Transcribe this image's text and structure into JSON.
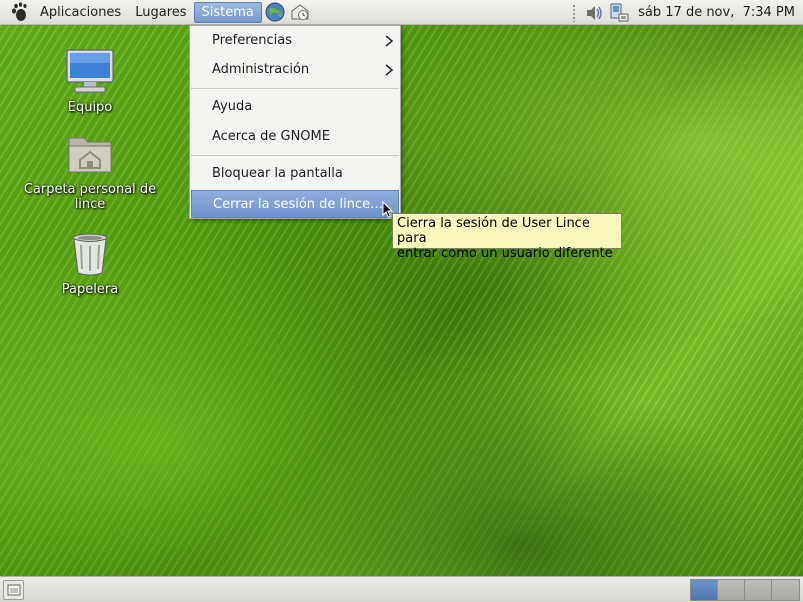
{
  "top_panel": {
    "menus": [
      "Aplicaciones",
      "Lugares",
      "Sistema"
    ],
    "active_menu": "Sistema",
    "launchers": [
      "web-browser-icon",
      "mail-client-icon"
    ],
    "tray_icons": [
      "volume-icon",
      "network-icon"
    ],
    "clock": "sáb 17 de nov,  7:34 PM"
  },
  "desktop": {
    "icons": [
      {
        "label": "Equipo",
        "icon": "computer-icon"
      },
      {
        "label": "Carpeta personal de lince",
        "icon": "home-folder-icon"
      },
      {
        "label": "Papelera",
        "icon": "trash-icon"
      }
    ]
  },
  "sistema_menu": {
    "groups": [
      [
        {
          "label": "Preferencias",
          "submenu": true
        },
        {
          "label": "Administración",
          "submenu": true
        }
      ],
      [
        {
          "label": "Ayuda",
          "submenu": false
        },
        {
          "label": "Acerca de GNOME",
          "submenu": false
        }
      ],
      [
        {
          "label": "Bloquear la pantalla",
          "submenu": false
        },
        {
          "label": "Cerrar la sesión de lince…",
          "submenu": false,
          "highlighted": true
        }
      ]
    ]
  },
  "tooltip": {
    "line1": "Cierra la sesión de User Lince para",
    "line2": "entrar como un usuario diferente"
  },
  "bottom_panel": {
    "workspaces": 4,
    "current_workspace": 1
  },
  "colors": {
    "highlight": "#7699cc",
    "tooltip_bg": "#f9f6be",
    "wallpaper": "#57a013"
  }
}
